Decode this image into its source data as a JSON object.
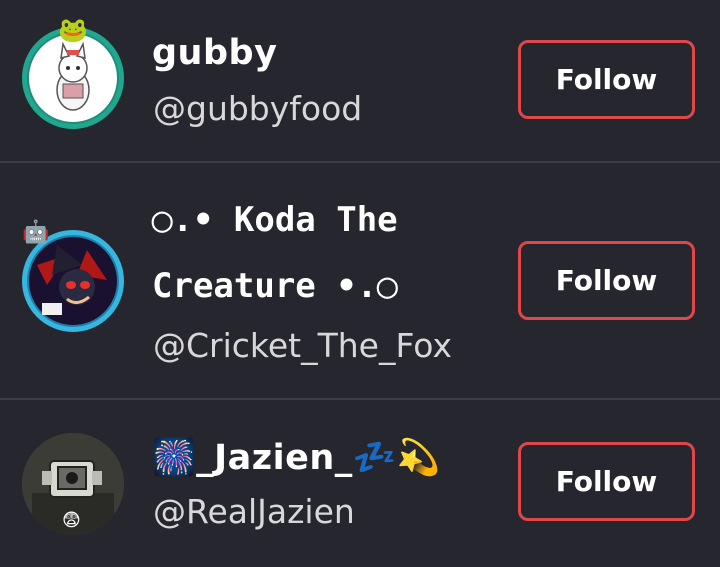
{
  "users": [
    {
      "display_name": "gubby",
      "handle": "@gubbyfood",
      "follow_label": "Follow",
      "avatar_icon": "white-creature-avatar",
      "frame_icon": "frog-frame-icon",
      "frame_color": "#20a88f"
    },
    {
      "display_name_line1": "◯.• Koda The",
      "display_name_line2": "Creature •.◯",
      "handle": "@Cricket_The_Fox",
      "follow_label": "Follow",
      "avatar_icon": "hedgehog-character-avatar",
      "frame_icon": "robot-frame-icon",
      "frame_color": "#37b6e0"
    },
    {
      "display_name": "🎆_Jazien_💤💫",
      "handle": "@RealJazien",
      "follow_label": "Follow",
      "avatar_icon": "camera-head-avatar",
      "frame_icon": "scared-face-icon"
    }
  ],
  "colors": {
    "background": "#26262e",
    "divider": "#3d3d46",
    "follow_border": "#e0474a"
  }
}
